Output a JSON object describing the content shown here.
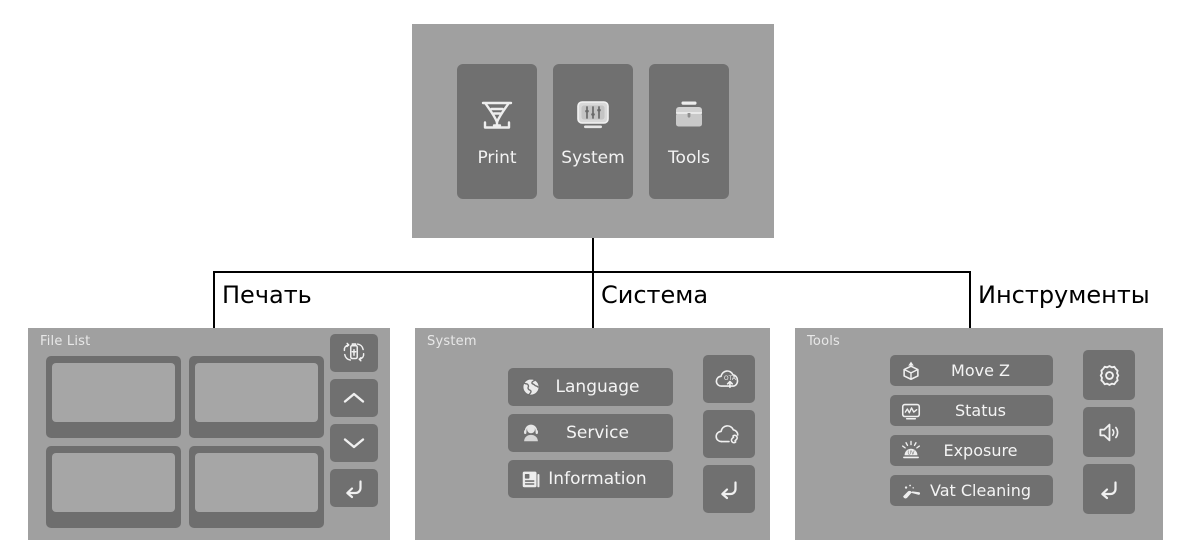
{
  "main_menu": {
    "tiles": [
      {
        "label": "Print",
        "icon": "vat-funnel-icon"
      },
      {
        "label": "System",
        "icon": "monitor-sliders-icon"
      },
      {
        "label": "Tools",
        "icon": "toolbox-icon"
      }
    ]
  },
  "callouts": [
    {
      "text": "Печать",
      "for": "Print"
    },
    {
      "text": "Система",
      "for": "System"
    },
    {
      "text": "Инструменты",
      "for": "Tools"
    }
  ],
  "print_panel": {
    "title": "File List",
    "file_cards": [
      "",
      "",
      "",
      ""
    ],
    "rail": [
      {
        "icon": "usb-switch-storage-icon"
      },
      {
        "icon": "chevron-up-icon"
      },
      {
        "icon": "chevron-down-icon"
      },
      {
        "icon": "back-arrow-icon"
      }
    ]
  },
  "system_panel": {
    "title": "System",
    "menu": [
      {
        "label": "Language",
        "icon": "globe-icon"
      },
      {
        "label": "Service",
        "icon": "headset-support-icon"
      },
      {
        "label": "Information",
        "icon": "document-info-icon"
      }
    ],
    "rail": [
      {
        "icon": "cloud-ota-update-icon"
      },
      {
        "icon": "cloud-link-icon"
      },
      {
        "icon": "back-arrow-icon"
      }
    ]
  },
  "tools_panel": {
    "title": "Tools",
    "menu": [
      {
        "label": "Move Z",
        "icon": "cube-move-z-icon"
      },
      {
        "label": "Status",
        "icon": "monitor-waveform-icon"
      },
      {
        "label": "Exposure",
        "icon": "uv-lamp-icon"
      },
      {
        "label": "Vat Cleaning",
        "icon": "spatula-clean-icon"
      }
    ],
    "rail": [
      {
        "icon": "gear-icon"
      },
      {
        "icon": "speaker-volume-icon"
      },
      {
        "icon": "back-arrow-icon"
      }
    ]
  },
  "colors": {
    "panel_background": "#a0a0a0",
    "button_fill": "#707070",
    "card_frame": "#6e6e6e",
    "card_thumb": "#a6a6a6",
    "icon_light": "#f2f2f2",
    "label_text": "#f4f4f4",
    "line": "#000000",
    "callout_text": "#000000",
    "page_background": "#ffffff"
  }
}
